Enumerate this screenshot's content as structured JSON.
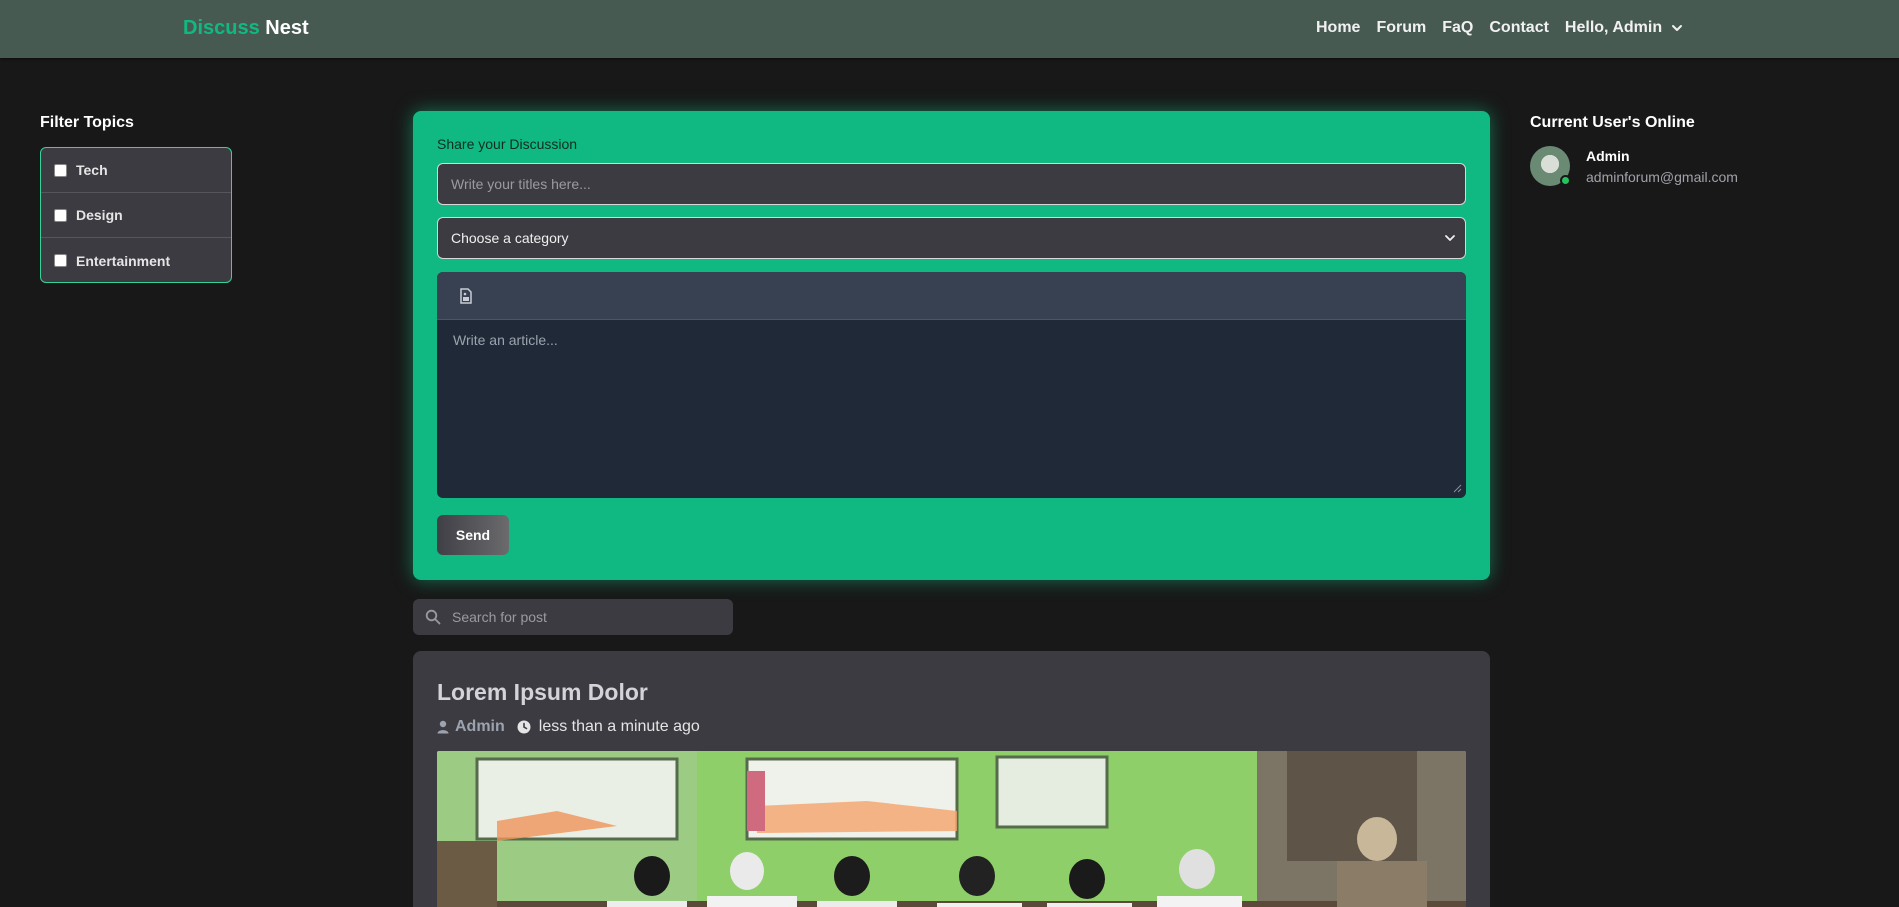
{
  "brand": {
    "part1": "Discuss",
    "part2": "Nest"
  },
  "nav": {
    "links": [
      "Home",
      "Forum",
      "FaQ",
      "Contact"
    ],
    "user_greeting": "Hello, Admin"
  },
  "filter": {
    "title": "Filter Topics",
    "items": [
      {
        "label": "Tech",
        "checked": false
      },
      {
        "label": "Design",
        "checked": false
      },
      {
        "label": "Entertainment",
        "checked": false
      }
    ]
  },
  "composer": {
    "label": "Share your Discussion",
    "title_placeholder": "Write your titles here...",
    "category_value": "Choose a category",
    "article_placeholder": "Write an article...",
    "send_label": "Send"
  },
  "search": {
    "placeholder": "Search for post"
  },
  "post": {
    "title": "Lorem Ipsum Dolor",
    "author": "Admin",
    "time": "less than a minute ago"
  },
  "online": {
    "title": "Current User's Online",
    "users": [
      {
        "name": "Admin",
        "email": "adminforum@gmail.com"
      }
    ]
  },
  "colors": {
    "accent": "#10b981",
    "navbar": "#475a52",
    "background": "#181818",
    "card": "#3b3b41"
  }
}
